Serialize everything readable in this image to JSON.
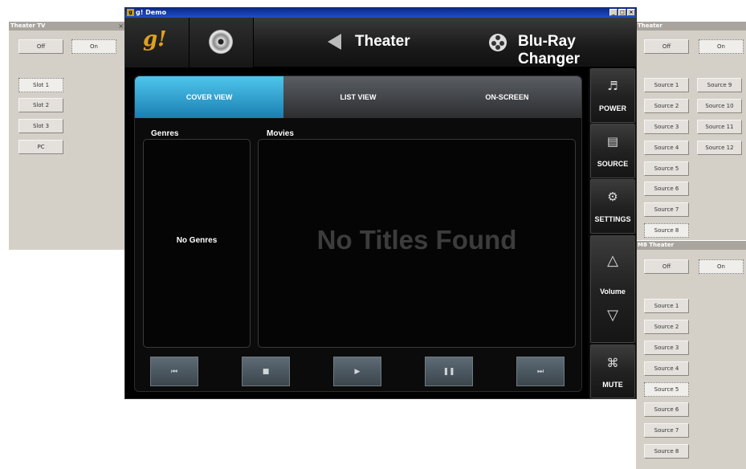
{
  "panels": {
    "theater_tv": {
      "title": "Theater TV",
      "close": "×",
      "off": "Off",
      "on": "On",
      "slots": [
        "Slot 1",
        "Slot 2",
        "Slot 3",
        "PC"
      ]
    },
    "theater": {
      "title": "Theater",
      "off": "Off",
      "on": "On",
      "sources_left": [
        "Source 1",
        "Source 2",
        "Source 3",
        "Source 4",
        "Source 5",
        "Source 6",
        "Source 7",
        "Source 8"
      ],
      "sources_right": [
        "Source 9",
        "Source 10",
        "Source 11",
        "Source 12"
      ]
    },
    "m8_theater": {
      "title": "M8 Theater",
      "off": "Off",
      "on": "On",
      "sources": [
        "Source 1",
        "Source 2",
        "Source 3",
        "Source 4",
        "Source 5",
        "Source 6",
        "Source 7",
        "Source 8"
      ]
    }
  },
  "app": {
    "window_title": "g! Demo",
    "icon_glyph": "g",
    "window_buttons": [
      "_",
      "□",
      "×"
    ],
    "logo": "g!",
    "zone_title": "Theater",
    "device_title": "Blu-Ray Changer",
    "tabs": [
      "COVER VIEW",
      "LIST VIEW",
      "ON-SCREEN"
    ],
    "active_tab": "COVER VIEW",
    "genres_label": "Genres",
    "movies_label": "Movies",
    "no_genres": "No Genres",
    "no_titles": "No Titles Found",
    "transport": [
      "⏮",
      "■",
      "▶",
      "❚❚",
      "⏭"
    ],
    "side_menu": {
      "power": "POWER",
      "source": "SOURCE",
      "settings": "SETTINGS",
      "volume": "Volume",
      "mute": "MUTE"
    },
    "icons": {
      "power": "♬",
      "source": "▤",
      "settings": "⚙",
      "volume_up": "△",
      "volume_down": "▽",
      "mute": "⌘"
    }
  }
}
